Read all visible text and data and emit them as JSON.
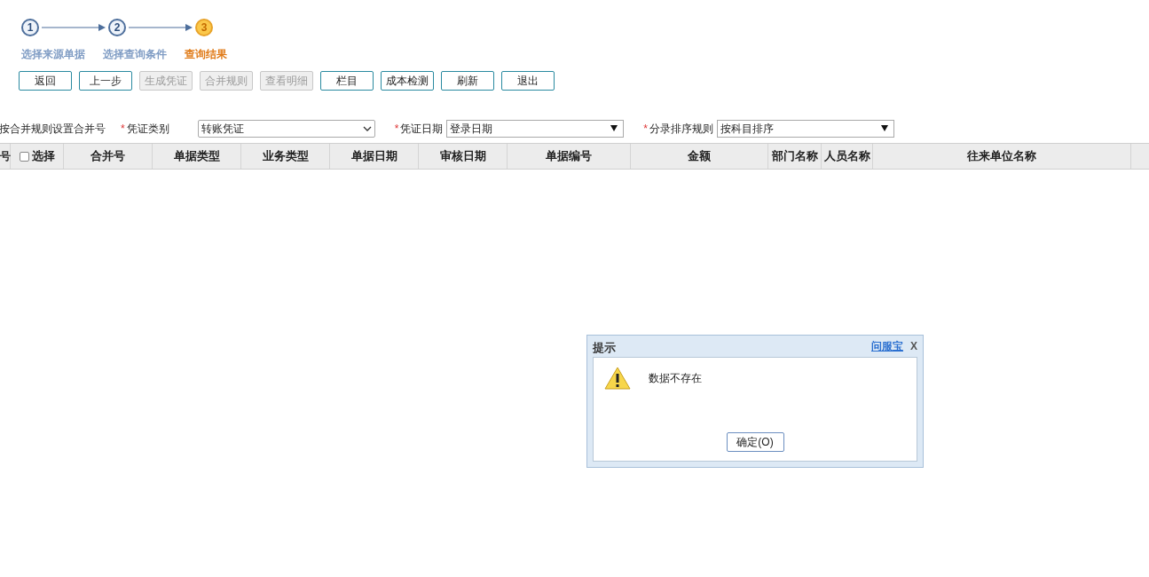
{
  "steps": [
    {
      "number": "1",
      "label": "选择来源单据",
      "current": false
    },
    {
      "number": "2",
      "label": "选择查询条件",
      "current": false
    },
    {
      "number": "3",
      "label": "查询结果",
      "current": true
    }
  ],
  "toolbar": [
    {
      "label": "返回",
      "disabled": false
    },
    {
      "label": "上一步",
      "disabled": false
    },
    {
      "label": "生成凭证",
      "disabled": true
    },
    {
      "label": "合并规则",
      "disabled": true
    },
    {
      "label": "查看明细",
      "disabled": true
    },
    {
      "label": "栏目",
      "disabled": false
    },
    {
      "label": "成本检测",
      "disabled": false
    },
    {
      "label": "刷新",
      "disabled": false
    },
    {
      "label": "退出",
      "disabled": false
    }
  ],
  "merge_note": "按合并规则设置合并号",
  "filters": [
    {
      "label": "凭证类别",
      "value": "转账凭证",
      "required_mark": "*",
      "kind": "chevron"
    },
    {
      "label": "凭证日期",
      "value": "登录日期",
      "required_mark": "*",
      "kind": "triangle"
    },
    {
      "label": "分录排序规则",
      "value": "按科目排序",
      "required_mark": "*",
      "kind": "triangle"
    }
  ],
  "table": {
    "columns": [
      {
        "label": "号",
        "kind": "text"
      },
      {
        "label": "选择",
        "kind": "checkbox",
        "checked": false
      },
      {
        "label": "合并号",
        "kind": "text"
      },
      {
        "label": "单据类型",
        "kind": "text"
      },
      {
        "label": "业务类型",
        "kind": "text"
      },
      {
        "label": "单据日期",
        "kind": "text"
      },
      {
        "label": "审核日期",
        "kind": "text"
      },
      {
        "label": "单据编号",
        "kind": "text"
      },
      {
        "label": "金额",
        "kind": "text"
      },
      {
        "label": "部门名称",
        "kind": "text"
      },
      {
        "label": "人员名称",
        "kind": "text"
      },
      {
        "label": "往来单位名称",
        "kind": "text"
      }
    ]
  },
  "dialog": {
    "title": "提示",
    "help_link": "问服宝",
    "close": "X",
    "message": "数据不存在",
    "ok_button": "确定(O)"
  }
}
